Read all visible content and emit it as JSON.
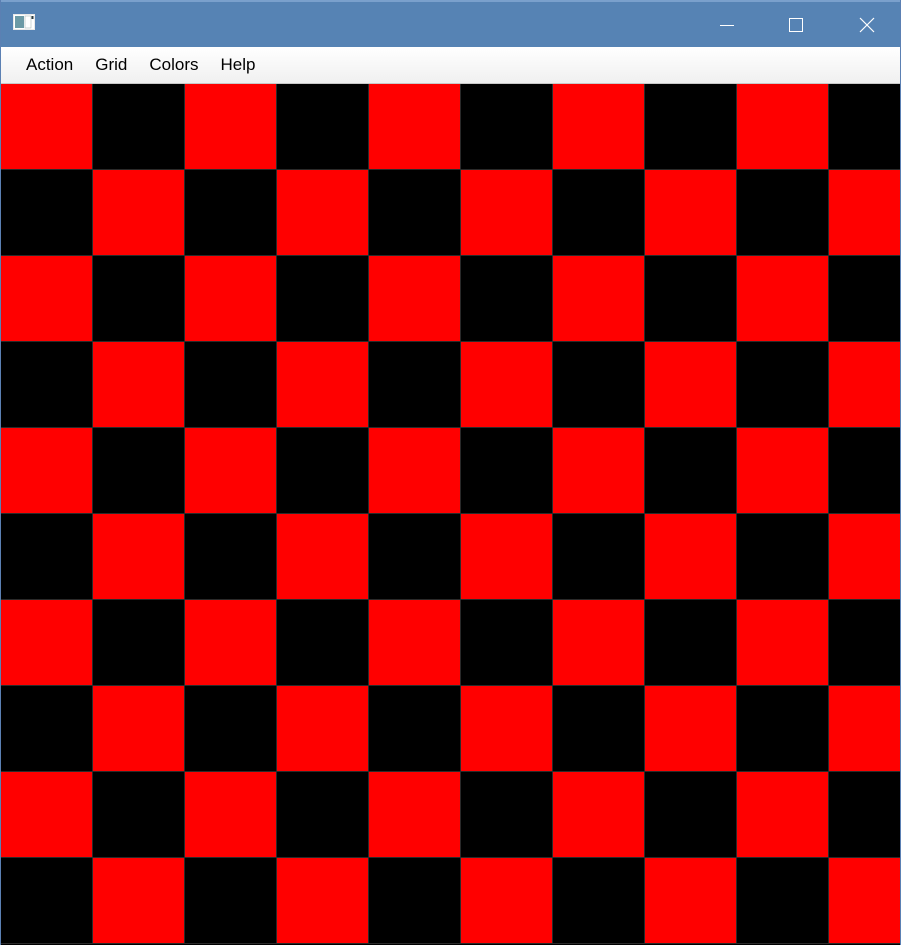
{
  "window": {
    "icon": "app-window-icon",
    "controls": {
      "minimize_icon": "minimize-icon",
      "maximize_icon": "maximize-icon",
      "close_icon": "close-icon"
    },
    "titlebar_color": "#5683b4"
  },
  "menu": {
    "items": [
      {
        "label": "Action"
      },
      {
        "label": "Grid"
      },
      {
        "label": "Colors"
      },
      {
        "label": "Help"
      }
    ]
  },
  "board": {
    "rows": 10,
    "cols": 10,
    "color_a": "#ff0000",
    "color_b": "#000000",
    "first_cell_color": "#ff0000"
  }
}
